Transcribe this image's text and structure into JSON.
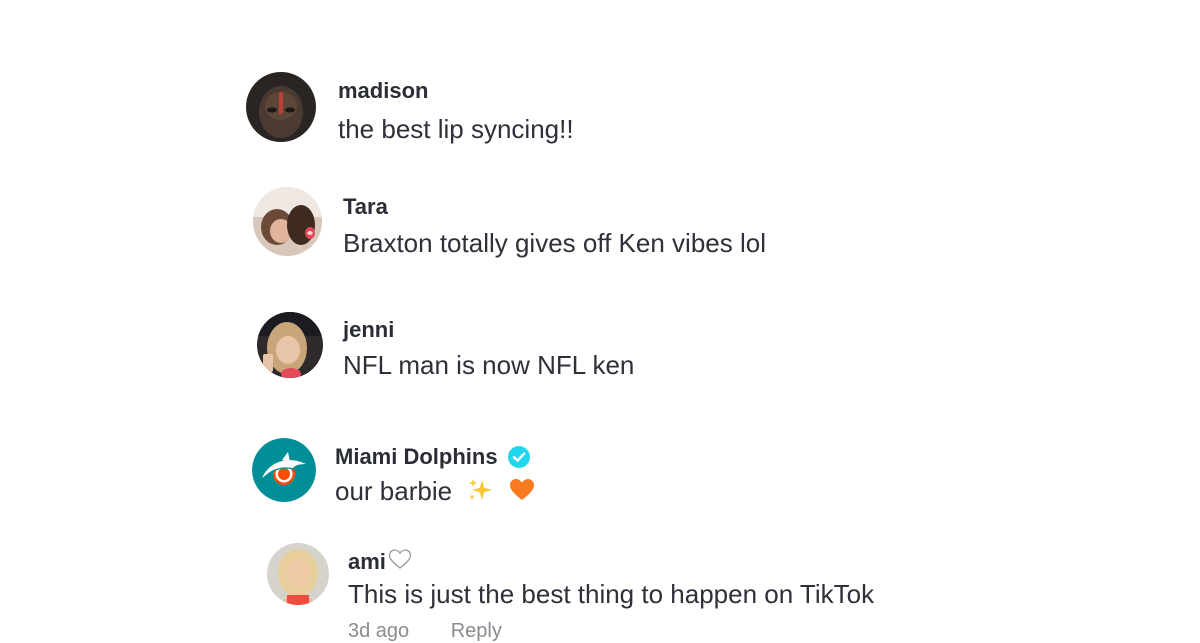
{
  "comments": [
    {
      "username": "madison",
      "text": "the best lip syncing!!"
    },
    {
      "username": "Tara",
      "text": "Braxton totally gives off Ken vibes lol"
    },
    {
      "username": "jenni",
      "text": "NFL man is now NFL ken"
    },
    {
      "username": "Miami Dolphins",
      "text": "our barbie",
      "emojis": [
        "sparkles-icon",
        "orange-heart-icon"
      ],
      "verified": true
    },
    {
      "username": "ami",
      "text": "This is just the best thing to happen on TikTok",
      "meta": {
        "age": "3d ago",
        "reply_label": "Reply"
      }
    }
  ],
  "colors": {
    "verified_badge": "#20d5ec",
    "dolphins_aqua": "#008e97",
    "dolphins_orange": "#fc4c02",
    "orange_heart": "#f97a1f",
    "sparkles": "#f7c536"
  }
}
